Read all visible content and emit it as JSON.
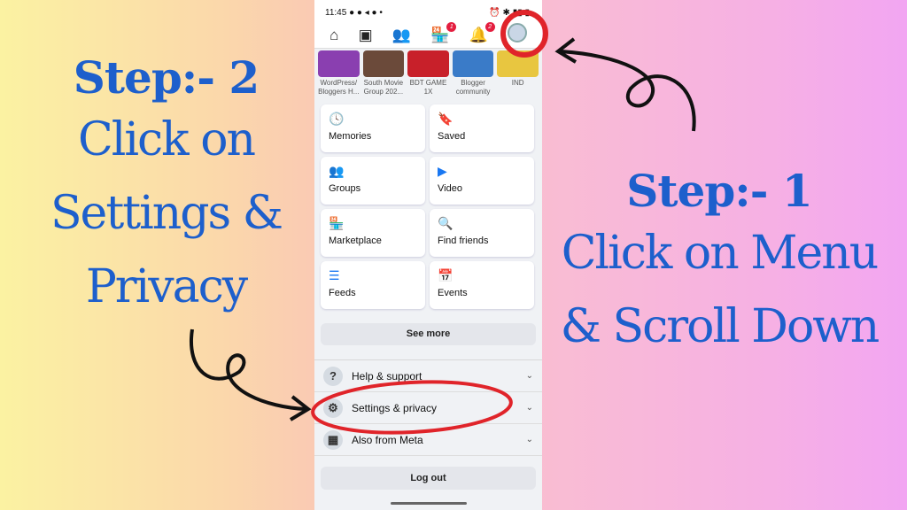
{
  "left_instruction": {
    "heading": "Step:- 2",
    "lines": [
      "Click on",
      "Settings &",
      "Privacy"
    ]
  },
  "right_instruction": {
    "heading": "Step:- 1",
    "lines": [
      "Click on Menu",
      "& Scroll Down"
    ]
  },
  "phone": {
    "status": {
      "time": "11:45",
      "icons": "● ● ◂ ● •",
      "right": "⏰ ✱ ▮▮ ▮"
    },
    "nav": {
      "icons": [
        "home-icon",
        "video-icon",
        "friends-icon",
        "marketplace-icon",
        "notifications-icon",
        "menu-avatar-icon"
      ],
      "marketplace_badge": "1",
      "notifications_badge": "2"
    },
    "groups": [
      {
        "name": "WordPress/ Bloggers H..."
      },
      {
        "name": "South Movie Group 202..."
      },
      {
        "name": "BDT GAME 1X"
      },
      {
        "name": "Blogger community"
      },
      {
        "name": "IND"
      }
    ],
    "shortcuts": [
      {
        "label": "Memories",
        "icon": "🕓",
        "color": "#1877f2"
      },
      {
        "label": "Saved",
        "icon": "🔖",
        "color": "#9b3bd1"
      },
      {
        "label": "Groups",
        "icon": "👥",
        "color": "#1877f2"
      },
      {
        "label": "Video",
        "icon": "▶",
        "color": "#1877f2"
      },
      {
        "label": "Marketplace",
        "icon": "🏪",
        "color": "#1877f2"
      },
      {
        "label": "Find friends",
        "icon": "🔍",
        "color": "#1877f2"
      },
      {
        "label": "Feeds",
        "icon": "☰",
        "color": "#1877f2"
      },
      {
        "label": "Events",
        "icon": "📅",
        "color": "#e41e3f"
      }
    ],
    "see_more": "See more",
    "menu": [
      {
        "label": "Help & support",
        "icon": "?"
      },
      {
        "label": "Settings & privacy",
        "icon": "⚙"
      },
      {
        "label": "Also from Meta",
        "icon": "▦"
      }
    ],
    "log_out": "Log out"
  },
  "colors": {
    "text_blue": "#1d5fcc",
    "highlight_red": "#e0242a"
  }
}
